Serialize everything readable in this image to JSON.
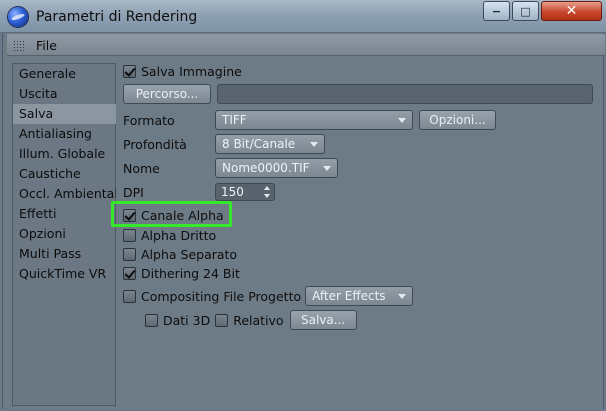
{
  "window": {
    "title": "Parametri di Rendering",
    "minimize_glyph": "−",
    "maximize_glyph": "□",
    "close_glyph": "✕"
  },
  "menu": {
    "file": "File"
  },
  "sidebar": {
    "items": [
      {
        "label": "Generale"
      },
      {
        "label": "Uscita"
      },
      {
        "label": "Salva",
        "selected": true
      },
      {
        "label": "Antialiasing"
      },
      {
        "label": "Illum. Globale"
      },
      {
        "label": "Caustiche"
      },
      {
        "label": "Occl. Ambientale"
      },
      {
        "label": "Effetti"
      },
      {
        "label": "Opzioni"
      },
      {
        "label": "Multi Pass"
      },
      {
        "label": "QuickTime VR"
      }
    ]
  },
  "salva": {
    "salva_immagine": {
      "label": "Salva Immagine",
      "checked": true
    },
    "percorso_button": "Percorso...",
    "percorso_value": "",
    "formato": {
      "label": "Formato",
      "value": "TIFF"
    },
    "opzioni_button": "Opzioni...",
    "profondita": {
      "label": "Profondità",
      "value": "8 Bit/Canale"
    },
    "nome": {
      "label": "Nome",
      "value": "Nome0000.TIF"
    },
    "dpi": {
      "label": "DPI",
      "value": "150"
    },
    "canale_alpha": {
      "label": "Canale Alpha",
      "checked": true
    },
    "alpha_dritto": {
      "label": "Alpha Dritto",
      "checked": false
    },
    "alpha_separato": {
      "label": "Alpha Separato",
      "checked": false
    },
    "dithering": {
      "label": "Dithering 24 Bit",
      "checked": true
    },
    "compositing": {
      "label": "Compositing File Progetto",
      "checked": false,
      "value": "After Effects"
    },
    "dati_3d": {
      "label": "Dati 3D",
      "checked": false
    },
    "relativo": {
      "label": "Relativo",
      "checked": false
    },
    "salva_button": "Salva..."
  },
  "colors": {
    "highlight": "#35e82a",
    "panel_bg": "#6d7b87",
    "selected_item": "#8b96a0"
  }
}
